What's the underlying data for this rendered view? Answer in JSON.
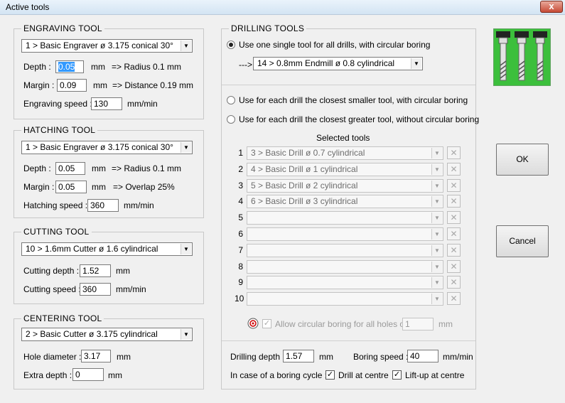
{
  "window": {
    "title": "Active tools",
    "close_glyph": "x"
  },
  "engraving": {
    "legend": "ENGRAVING TOOL",
    "tool": "1 > Basic Engraver   ø 3.175   conical 30°",
    "depth_label": "Depth :",
    "depth_value": "0.05",
    "depth_unit": "mm",
    "depth_info": "=> Radius 0.1 mm",
    "margin_label": "Margin :",
    "margin_value": "0.09",
    "margin_unit": "mm",
    "margin_info": "=> Distance 0.19 mm",
    "speed_label": "Engraving speed :",
    "speed_value": "130",
    "speed_unit": "mm/min"
  },
  "hatching": {
    "legend": "HATCHING TOOL",
    "tool": "1 > Basic Engraver   ø 3.175   conical 30°",
    "depth_label": "Depth :",
    "depth_value": "0.05",
    "depth_unit": "mm",
    "depth_info": "=> Radius 0.1 mm",
    "margin_label": "Margin :",
    "margin_value": "0.05",
    "margin_unit": "mm",
    "margin_info": "=> Overlap 25%",
    "speed_label": "Hatching speed :",
    "speed_value": "360",
    "speed_unit": "mm/min"
  },
  "cutting": {
    "legend": "CUTTING TOOL",
    "tool": "10 > 1.6mm Cutter   ø 1.6   cylindrical",
    "depth_label": "Cutting depth :",
    "depth_value": "1.52",
    "depth_unit": "mm",
    "speed_label": "Cutting speed :",
    "speed_value": "360",
    "speed_unit": "mm/min"
  },
  "centering": {
    "legend": "CENTERING TOOL",
    "tool": "2 > Basic Cutter   ø 3.175   cylindrical",
    "hole_label": "Hole diameter :",
    "hole_value": "3.17",
    "hole_unit": "mm",
    "extra_label": "Extra depth :",
    "extra_value": "0",
    "extra_unit": "mm"
  },
  "drilling": {
    "legend": "DRILLING TOOLS",
    "opt_single": "Use one single tool for all drills, with circular boring",
    "arrow_prefix": "--->",
    "single_tool": "14 > 0.8mm Endmill   ø 0.8   cylindrical",
    "opt_smaller": "Use for each drill the closest smaller tool, with circular boring",
    "opt_greater": "Use for each drill the closest greater tool, without circular boring",
    "selected_title": "Selected tools",
    "rows": [
      {
        "n": "1",
        "tool": "3 > Basic Drill   ø 0.7   cylindrical"
      },
      {
        "n": "2",
        "tool": "4 > Basic Drill   ø 1   cylindrical"
      },
      {
        "n": "3",
        "tool": "5 > Basic Drill   ø 2   cylindrical"
      },
      {
        "n": "4",
        "tool": "6 > Basic Drill   ø 3   cylindrical"
      },
      {
        "n": "5",
        "tool": ""
      },
      {
        "n": "6",
        "tool": ""
      },
      {
        "n": "7",
        "tool": ""
      },
      {
        "n": "8",
        "tool": ""
      },
      {
        "n": "9",
        "tool": ""
      },
      {
        "n": "10",
        "tool": ""
      }
    ],
    "allow_boring_label": "Allow circular boring for all holes over",
    "allow_boring_value": "1",
    "allow_boring_unit": "mm",
    "drill_depth_label": "Drilling depth :",
    "drill_depth_value": "1.57",
    "drill_depth_unit": "mm",
    "boring_speed_label": "Boring speed :",
    "boring_speed_value": "40",
    "boring_speed_unit": "mm/min",
    "boring_cycle_label": "In case of a boring cycle :",
    "drill_centre_label": "Drill at centre",
    "liftup_label": "Lift-up at centre"
  },
  "buttons": {
    "ok": "OK",
    "cancel": "Cancel"
  },
  "colors": {
    "tools_image_bg": "#3cbf3c",
    "selection": "#3399ff"
  },
  "icons": {
    "close": "close-icon",
    "combo_arrow": "chevron-down-icon",
    "remove": "remove-icon",
    "tools_image": "drill-bits-icon",
    "target": "target-icon"
  }
}
